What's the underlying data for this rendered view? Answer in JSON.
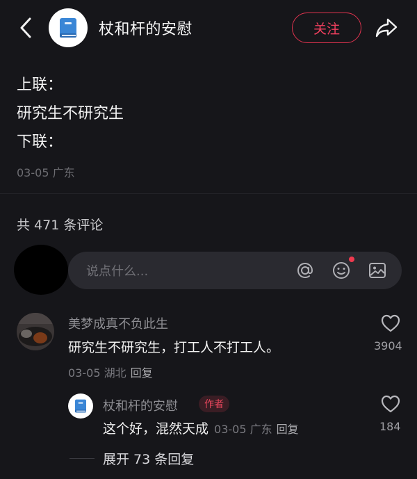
{
  "header": {
    "author_name": "杖和杆的安慰",
    "follow_label": "关注",
    "back_icon": "chevron-left-icon",
    "share_icon": "share-arrow-icon",
    "avatar_icon": "book-icon"
  },
  "post": {
    "lines": [
      "上联：",
      "研究生不研究生",
      "下联："
    ],
    "meta": "03-05 广东"
  },
  "comments_header": {
    "count_text": "共 471 条评论"
  },
  "comment_input": {
    "placeholder": "说点什么...",
    "icons": [
      "at-icon",
      "emoji-icon",
      "image-icon"
    ]
  },
  "comments": [
    {
      "user": "美梦成真不负此生",
      "text": "研究生不研究生，打工人不打工人。",
      "date_location": "03-05 湖北",
      "reply_label": "回复",
      "likes": "3904",
      "replies": [
        {
          "user": "杖和杆的安慰",
          "tag": "作者",
          "text": "这个好，混然天成",
          "date_location": "03-05 广东",
          "reply_label": "回复",
          "likes": "184"
        }
      ],
      "expand_label": "展开 73 条回复"
    }
  ],
  "colors": {
    "background": "#16161a",
    "accent": "#e0334f"
  }
}
